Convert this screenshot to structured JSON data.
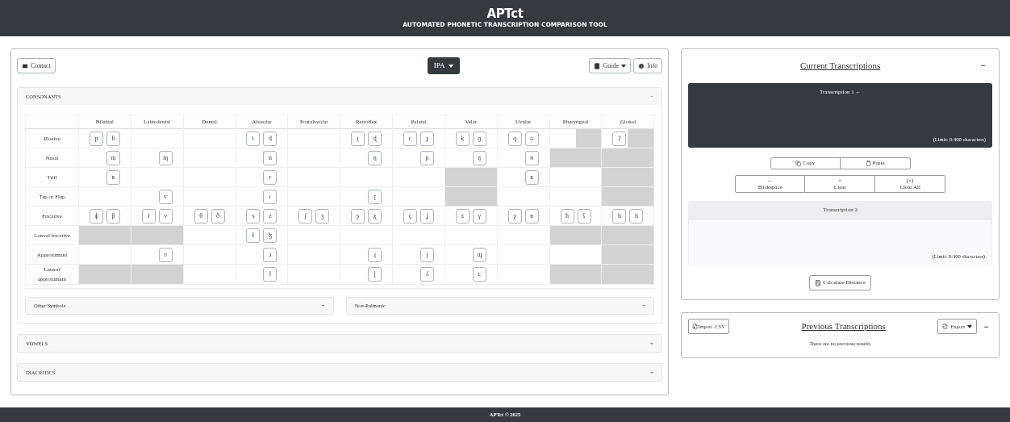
{
  "header": {
    "title": "APTct",
    "subtitle": "AUTOMATED PHONETIC TRANSCRIPTION COMPARISON TOOL"
  },
  "toolbar": {
    "contact": "Contact",
    "alphabet": "IPA",
    "guide": "Guide",
    "info": "Info"
  },
  "consonants": {
    "title": "CONSONANTS",
    "toggle": "−",
    "columns": [
      "Bilabial",
      "Labiodental",
      "Dental",
      "Alveolar",
      "Postalveolar",
      "Retroflex",
      "Palatal",
      "Velar",
      "Uvular",
      "Pharyngeal",
      "Glottal"
    ],
    "rows": [
      {
        "label": "Plosive",
        "cells": [
          {
            "voiceless": "p",
            "voiced": "b",
            "left_shaded": false,
            "right_shaded": false
          },
          {
            "left_shaded": false,
            "right_shaded": false
          },
          {
            "left_shaded": false,
            "right_shaded": false
          },
          {
            "voiceless": "t",
            "voiced": "d",
            "left_shaded": false,
            "right_shaded": false
          },
          {
            "left_shaded": false,
            "right_shaded": false
          },
          {
            "voiceless": "ʈ",
            "voiced": "ɖ",
            "left_shaded": false,
            "right_shaded": false
          },
          {
            "voiceless": "c",
            "voiced": "ɟ",
            "left_shaded": false,
            "right_shaded": false
          },
          {
            "voiceless": "k",
            "voiced": "ɡ",
            "left_shaded": false,
            "right_shaded": false
          },
          {
            "voiceless": "q",
            "voiced": "ɢ",
            "left_shaded": false,
            "right_shaded": false
          },
          {
            "left_shaded": false,
            "right_shaded": true
          },
          {
            "voiceless": "ʔ",
            "left_shaded": false,
            "right_shaded": true
          }
        ]
      },
      {
        "label": "Nasal",
        "cells": [
          {
            "voiced": "m",
            "left_shaded": false,
            "right_shaded": false
          },
          {
            "voiced": "ɱ",
            "left_shaded": false,
            "right_shaded": false
          },
          {
            "left_shaded": false,
            "right_shaded": false
          },
          {
            "voiced": "n",
            "left_shaded": false,
            "right_shaded": false
          },
          {
            "left_shaded": false,
            "right_shaded": false
          },
          {
            "voiced": "ɳ",
            "left_shaded": false,
            "right_shaded": false
          },
          {
            "voiced": "ɲ",
            "left_shaded": false,
            "right_shaded": false
          },
          {
            "voiced": "ŋ",
            "left_shaded": false,
            "right_shaded": false
          },
          {
            "voiced": "ɴ",
            "left_shaded": false,
            "right_shaded": false
          },
          {
            "left_shaded": true,
            "right_shaded": true
          },
          {
            "left_shaded": true,
            "right_shaded": true
          }
        ]
      },
      {
        "label": "Trill",
        "cells": [
          {
            "voiced": "ʙ",
            "left_shaded": false,
            "right_shaded": false
          },
          {
            "left_shaded": false,
            "right_shaded": false
          },
          {
            "left_shaded": false,
            "right_shaded": false
          },
          {
            "voiced": "r",
            "left_shaded": false,
            "right_shaded": false
          },
          {
            "left_shaded": false,
            "right_shaded": false
          },
          {
            "left_shaded": false,
            "right_shaded": false
          },
          {
            "left_shaded": false,
            "right_shaded": false
          },
          {
            "left_shaded": true,
            "right_shaded": true
          },
          {
            "voiced": "ʀ",
            "left_shaded": false,
            "right_shaded": false
          },
          {
            "left_shaded": false,
            "right_shaded": false
          },
          {
            "left_shaded": true,
            "right_shaded": true
          }
        ]
      },
      {
        "label": "Tap or Flap",
        "cells": [
          {
            "left_shaded": false,
            "right_shaded": false
          },
          {
            "voiced": "ⱱ",
            "left_shaded": false,
            "right_shaded": false
          },
          {
            "left_shaded": false,
            "right_shaded": false
          },
          {
            "voiced": "ɾ",
            "left_shaded": false,
            "right_shaded": false
          },
          {
            "left_shaded": false,
            "right_shaded": false
          },
          {
            "voiced": "ɽ",
            "left_shaded": false,
            "right_shaded": false
          },
          {
            "left_shaded": false,
            "right_shaded": false
          },
          {
            "left_shaded": true,
            "right_shaded": true
          },
          {
            "left_shaded": false,
            "right_shaded": false
          },
          {
            "left_shaded": false,
            "right_shaded": false
          },
          {
            "left_shaded": true,
            "right_shaded": true
          }
        ]
      },
      {
        "label": "Fricative",
        "cells": [
          {
            "voiceless": "ɸ",
            "voiced": "β",
            "left_shaded": false,
            "right_shaded": false
          },
          {
            "voiceless": "f",
            "voiced": "v",
            "left_shaded": false,
            "right_shaded": false
          },
          {
            "voiceless": "θ",
            "voiced": "ð",
            "left_shaded": false,
            "right_shaded": false
          },
          {
            "voiceless": "s",
            "voiced": "z",
            "left_shaded": false,
            "right_shaded": false
          },
          {
            "voiceless": "ʃ",
            "voiced": "ʒ",
            "left_shaded": false,
            "right_shaded": false
          },
          {
            "voiceless": "ʂ",
            "voiced": "ʐ",
            "left_shaded": false,
            "right_shaded": false
          },
          {
            "voiceless": "ç",
            "voiced": "ʝ",
            "left_shaded": false,
            "right_shaded": false
          },
          {
            "voiceless": "x",
            "voiced": "ɣ",
            "left_shaded": false,
            "right_shaded": false
          },
          {
            "voiceless": "χ",
            "voiced": "ʁ",
            "left_shaded": false,
            "right_shaded": false
          },
          {
            "voiceless": "ħ",
            "voiced": "ʕ",
            "left_shaded": false,
            "right_shaded": false
          },
          {
            "voiceless": "h",
            "voiced": "ɦ",
            "left_shaded": false,
            "right_shaded": false
          }
        ]
      },
      {
        "label": "Lateral fricative",
        "cells": [
          {
            "left_shaded": true,
            "right_shaded": true
          },
          {
            "left_shaded": true,
            "right_shaded": true
          },
          {
            "left_shaded": false,
            "right_shaded": false
          },
          {
            "voiceless": "ɬ",
            "voiced": "ɮ",
            "left_shaded": false,
            "right_shaded": false
          },
          {
            "left_shaded": false,
            "right_shaded": false
          },
          {
            "left_shaded": false,
            "right_shaded": false
          },
          {
            "left_shaded": false,
            "right_shaded": false
          },
          {
            "left_shaded": false,
            "right_shaded": false
          },
          {
            "left_shaded": false,
            "right_shaded": false
          },
          {
            "left_shaded": true,
            "right_shaded": true
          },
          {
            "left_shaded": true,
            "right_shaded": true
          }
        ]
      },
      {
        "label": "Approximant",
        "cells": [
          {
            "left_shaded": false,
            "right_shaded": false
          },
          {
            "voiced": "ʋ",
            "left_shaded": false,
            "right_shaded": false
          },
          {
            "left_shaded": false,
            "right_shaded": false
          },
          {
            "voiced": "ɹ",
            "left_shaded": false,
            "right_shaded": false
          },
          {
            "left_shaded": false,
            "right_shaded": false
          },
          {
            "voiced": "ɻ",
            "left_shaded": false,
            "right_shaded": false
          },
          {
            "voiced": "j",
            "left_shaded": false,
            "right_shaded": false
          },
          {
            "voiced": "ɰ",
            "left_shaded": false,
            "right_shaded": false
          },
          {
            "left_shaded": false,
            "right_shaded": false
          },
          {
            "left_shaded": false,
            "right_shaded": false
          },
          {
            "left_shaded": true,
            "right_shaded": true
          }
        ]
      },
      {
        "label": "Lateral approximant",
        "cells": [
          {
            "left_shaded": true,
            "right_shaded": true
          },
          {
            "left_shaded": true,
            "right_shaded": true
          },
          {
            "left_shaded": false,
            "right_shaded": false
          },
          {
            "voiced": "l",
            "left_shaded": false,
            "right_shaded": false
          },
          {
            "left_shaded": false,
            "right_shaded": false
          },
          {
            "voiced": "ɭ",
            "left_shaded": false,
            "right_shaded": false
          },
          {
            "voiced": "ʎ",
            "left_shaded": false,
            "right_shaded": false
          },
          {
            "voiced": "ʟ",
            "left_shaded": false,
            "right_shaded": false
          },
          {
            "left_shaded": false,
            "right_shaded": false
          },
          {
            "left_shaded": true,
            "right_shaded": true
          },
          {
            "left_shaded": true,
            "right_shaded": true
          }
        ]
      }
    ]
  },
  "sub_sections": [
    {
      "title": "Other Symbols",
      "toggle": "+"
    },
    {
      "title": "Non-Pulmonic",
      "toggle": "+"
    }
  ],
  "sections": [
    {
      "title": "VOWELS",
      "toggle": "+"
    },
    {
      "title": "DIACRITICS",
      "toggle": "+"
    }
  ],
  "current": {
    "title": "Current Transcriptions",
    "toggle": "−",
    "transcriptions": [
      {
        "label": "Transcription 1 ←",
        "limit": "(Limit: 0-300 characters)",
        "selected": true
      },
      {
        "label": "Transcription 2",
        "limit": "(Limit: 0-300 characters)",
        "selected": false
      }
    ],
    "clipboard_buttons": [
      "Copy",
      "Paste"
    ],
    "edit_buttons": [
      {
        "symbol": "←",
        "label": "Backspace"
      },
      {
        "symbol": "×",
        "label": "Clear"
      },
      {
        "symbol": "(×)",
        "label": "Clear All"
      }
    ],
    "calculate": "Calculate Distance"
  },
  "previous": {
    "import": "Import .CSV",
    "title": "Previous Transcriptions",
    "export": "Export",
    "toggle": "−",
    "empty_message": "There are no previous results."
  },
  "footer": "APTct © 2025"
}
